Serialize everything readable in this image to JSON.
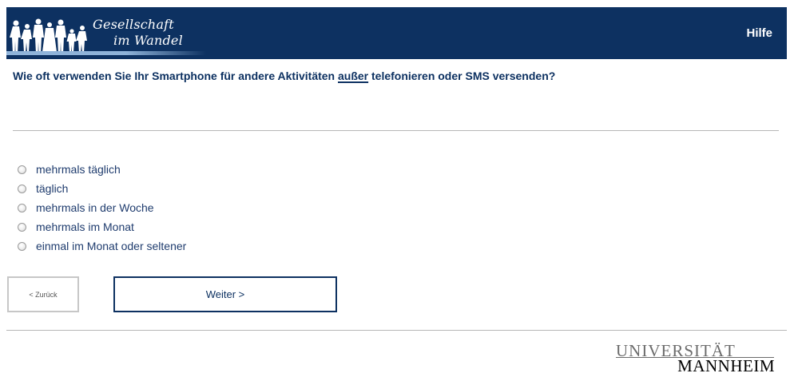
{
  "header": {
    "logo_line1": "Gesellschaft",
    "logo_line2": "im Wandel",
    "help_label": "Hilfe"
  },
  "question": {
    "before": "Wie oft verwenden Sie Ihr Smartphone für andere Aktivitäten ",
    "emphasis": "außer",
    "after": " telefonieren oder SMS versenden?"
  },
  "options": [
    {
      "label": "mehrmals täglich",
      "selected": false
    },
    {
      "label": "täglich",
      "selected": false
    },
    {
      "label": "mehrmals in der Woche",
      "selected": false
    },
    {
      "label": "mehrmals im Monat",
      "selected": false
    },
    {
      "label": "einmal im Monat oder seltener",
      "selected": false
    }
  ],
  "navigation": {
    "back_label": "< Zurück",
    "next_label": "Weiter >"
  },
  "footer": {
    "university_line1": "UNIVERSITÄT",
    "university_line2": "MANNHEIM"
  },
  "colors": {
    "header_bg": "#0d3161",
    "accent": "#0d3161",
    "option_text": "#1f3c6e",
    "divider": "#b7b7b7"
  }
}
